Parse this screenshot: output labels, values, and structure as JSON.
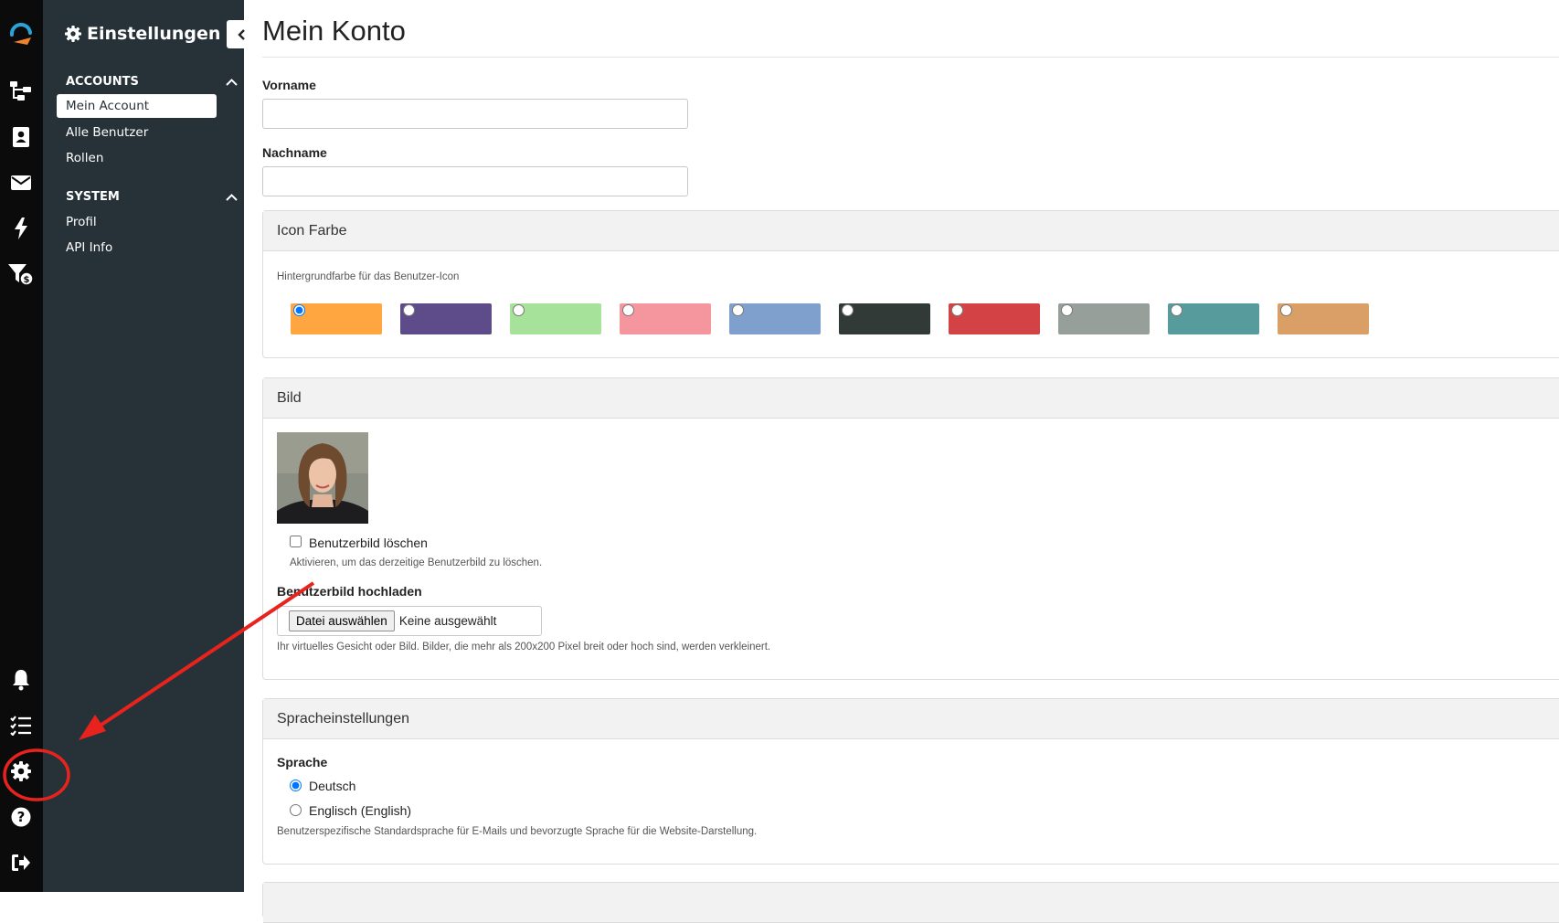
{
  "sidebar": {
    "title": "Einstellungen",
    "sections": [
      {
        "heading": "ACCOUNTS",
        "items": [
          {
            "label": "Mein Account",
            "active": true
          },
          {
            "label": "Alle Benutzer"
          },
          {
            "label": "Rollen"
          }
        ]
      },
      {
        "heading": "SYSTEM",
        "items": [
          {
            "label": "Profil"
          },
          {
            "label": "API Info"
          }
        ]
      }
    ]
  },
  "icons": {
    "rail_top": [
      "logo-icon",
      "hierarchy-icon",
      "contacts-icon",
      "mail-icon",
      "bolt-icon",
      "funnel-dollar-icon"
    ],
    "rail_bottom": [
      "bell-icon",
      "tasklist-icon",
      "gear-icon",
      "help-icon",
      "logout-icon"
    ]
  },
  "main": {
    "title": "Mein Konto",
    "vorname": {
      "label": "Vorname",
      "value": ""
    },
    "nachname": {
      "label": "Nachname",
      "value": ""
    },
    "icon_farbe": {
      "heading": "Icon Farbe",
      "help": "Hintergrundfarbe für das Benutzer-Icon",
      "colors": [
        "#ffa641",
        "#5e4c8a",
        "#a7e29a",
        "#f5969e",
        "#7f9fcc",
        "#323a38",
        "#d34244",
        "#969f9a",
        "#579b9d",
        "#d99f66"
      ],
      "selected_index": 0
    },
    "bild": {
      "heading": "Bild",
      "delete_label": "Benutzerbild löschen",
      "delete_help": "Aktivieren, um das derzeitige Benutzerbild zu löschen.",
      "upload_label": "Benutzerbild hochladen",
      "file_button": "Datei auswählen",
      "file_status": "Keine ausgewählt",
      "upload_help": "Ihr virtuelles Gesicht oder Bild. Bilder, die mehr als 200x200 Pixel breit oder hoch sind, werden verkleinert."
    },
    "sprache": {
      "heading": "Spracheinstellungen",
      "label": "Sprache",
      "options": [
        "Deutsch",
        "Englisch (English)"
      ],
      "selected_index": 0,
      "help": "Benutzerspezifische Standardsprache für E-Mails und bevorzugte Sprache für die Website-Darstellung."
    }
  }
}
